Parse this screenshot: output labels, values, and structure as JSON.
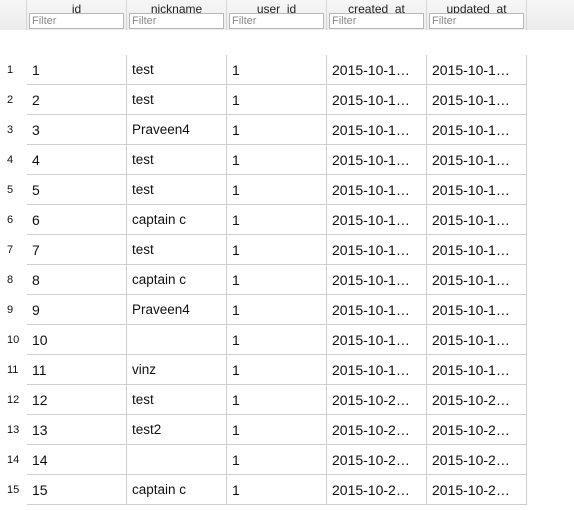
{
  "columns": [
    {
      "label": "id",
      "filter_placeholder": "Filter"
    },
    {
      "label": "nickname",
      "filter_placeholder": "Filter"
    },
    {
      "label": "user_id",
      "filter_placeholder": "Filter"
    },
    {
      "label": "created_at",
      "filter_placeholder": "Filter"
    },
    {
      "label": "updated_at",
      "filter_placeholder": "Filter"
    }
  ],
  "rows": [
    {
      "rownum": "1",
      "id": "1",
      "nickname": "test",
      "user_id": "1",
      "created_at": "2015-10-1…",
      "updated_at": "2015-10-1…"
    },
    {
      "rownum": "2",
      "id": "2",
      "nickname": "test",
      "user_id": "1",
      "created_at": "2015-10-1…",
      "updated_at": "2015-10-1…"
    },
    {
      "rownum": "3",
      "id": "3",
      "nickname": "Praveen4",
      "user_id": "1",
      "created_at": "2015-10-1…",
      "updated_at": "2015-10-1…"
    },
    {
      "rownum": "4",
      "id": "4",
      "nickname": "test",
      "user_id": "1",
      "created_at": "2015-10-1…",
      "updated_at": "2015-10-1…"
    },
    {
      "rownum": "5",
      "id": "5",
      "nickname": "test",
      "user_id": "1",
      "created_at": "2015-10-1…",
      "updated_at": "2015-10-1…"
    },
    {
      "rownum": "6",
      "id": "6",
      "nickname": "captain c",
      "user_id": "1",
      "created_at": "2015-10-1…",
      "updated_at": "2015-10-1…"
    },
    {
      "rownum": "7",
      "id": "7",
      "nickname": "test",
      "user_id": "1",
      "created_at": "2015-10-1…",
      "updated_at": "2015-10-1…"
    },
    {
      "rownum": "8",
      "id": "8",
      "nickname": "captain c",
      "user_id": "1",
      "created_at": "2015-10-1…",
      "updated_at": "2015-10-1…"
    },
    {
      "rownum": "9",
      "id": "9",
      "nickname": "Praveen4",
      "user_id": "1",
      "created_at": "2015-10-1…",
      "updated_at": "2015-10-1…"
    },
    {
      "rownum": "10",
      "id": "10",
      "nickname": "",
      "user_id": "1",
      "created_at": "2015-10-1…",
      "updated_at": "2015-10-1…"
    },
    {
      "rownum": "11",
      "id": "11",
      "nickname": "vinz",
      "user_id": "1",
      "created_at": "2015-10-1…",
      "updated_at": "2015-10-1…"
    },
    {
      "rownum": "12",
      "id": "12",
      "nickname": "test",
      "user_id": "1",
      "created_at": "2015-10-2…",
      "updated_at": "2015-10-2…"
    },
    {
      "rownum": "13",
      "id": "13",
      "nickname": "test2",
      "user_id": "1",
      "created_at": "2015-10-2…",
      "updated_at": "2015-10-2…"
    },
    {
      "rownum": "14",
      "id": "14",
      "nickname": "",
      "user_id": "1",
      "created_at": "2015-10-2…",
      "updated_at": "2015-10-2…"
    },
    {
      "rownum": "15",
      "id": "15",
      "nickname": "captain c",
      "user_id": "1",
      "created_at": "2015-10-2…",
      "updated_at": "2015-10-2…"
    }
  ]
}
